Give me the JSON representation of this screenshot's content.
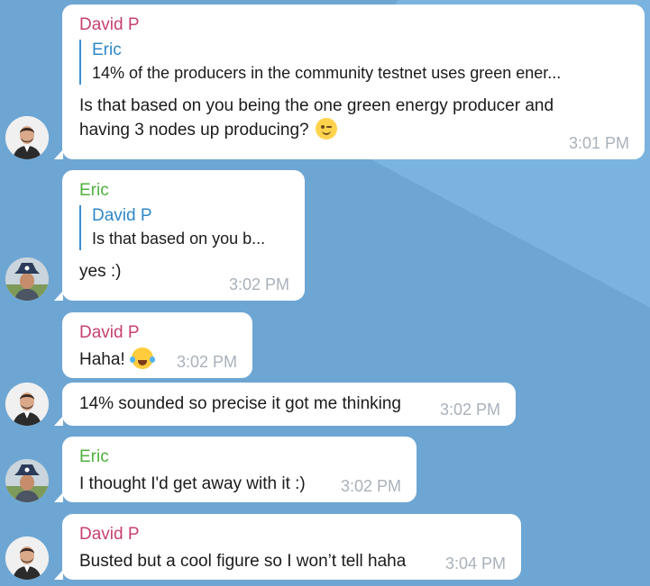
{
  "messages": [
    {
      "sender": "David P",
      "reply": {
        "name": "Eric",
        "text": "14% of the producers in the community testnet uses green ener..."
      },
      "text_line1": "Is that based on you being the one green energy producer and",
      "text_line2": "having 3 nodes up producing?",
      "emoji": "wink-emoji",
      "time": "3:01 PM"
    },
    {
      "sender": "Eric",
      "reply": {
        "name": "David P",
        "text": "Is that based on you b..."
      },
      "text": "yes :)",
      "time": "3:02 PM"
    },
    {
      "sender": "David P",
      "text": "Haha!",
      "emoji": "laughing-tears-emoji",
      "time": "3:02 PM"
    },
    {
      "text": "14% sounded so precise it got me thinking",
      "time": "3:02 PM"
    },
    {
      "sender": "Eric",
      "text": "I thought I'd get away with it :)",
      "time": "3:02 PM"
    },
    {
      "sender": "David P",
      "text": "Busted but a cool figure so I won’t tell haha",
      "time": "3:04 PM"
    }
  ],
  "colors": {
    "background": "#6ea6d3",
    "bubble": "#ffffff",
    "david_name": "#c7426c",
    "eric_name": "#4fb13c",
    "reply_accent": "#2f88c9",
    "time": "#a9b1ba"
  }
}
